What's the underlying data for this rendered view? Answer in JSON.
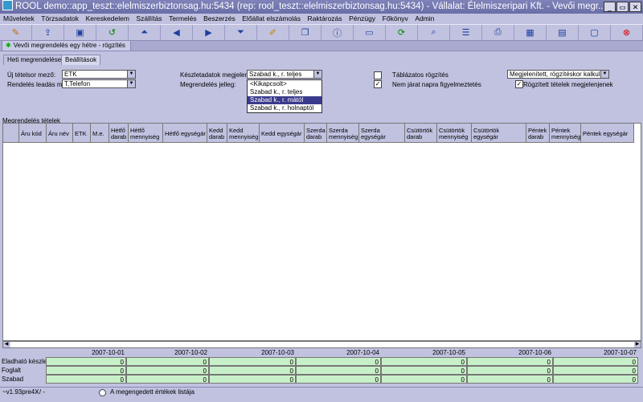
{
  "window": {
    "title": "ROOL demo::app_teszt::elelmiszerbiztonsag.hu:5434 (rep: rool_teszt::elelmiszerbiztonsag.hu:5434) - Vállalat: Élelmiszeripari Kft. - Vevői megr...",
    "min_label": "_",
    "restore_label": "▭",
    "close_label": "✕"
  },
  "menu": [
    "Műveletek",
    "Törzsadatok",
    "Kereskedelem",
    "Szállítás",
    "Termelés",
    "Beszerzés",
    "Előállat elszámolás",
    "Raktározás",
    "Pénzügy",
    "Főkönyv",
    "Admin"
  ],
  "toolbar": [
    "open-icon",
    "export-icon",
    "save-icon",
    "refresh-icon",
    "first-icon",
    "prev-icon",
    "next-icon",
    "last-icon",
    "edit-icon",
    "copy-icon",
    "info-icon",
    "window-icon",
    "reload-icon",
    "search-icon",
    "list-icon",
    "print-icon",
    "grid-icon",
    "table-icon",
    "frame-icon",
    "close-icon"
  ],
  "doc_tab": "Vevői megrendelés egy hétre - rögzítés",
  "subtabs": [
    "Heti megrendelések",
    "Beállítások"
  ],
  "form": {
    "new_row_label": "Új tételsor mező:",
    "new_row_value": "ETK",
    "order_mode_label": "Rendelés leadás mód:",
    "order_mode_value": "T,Telefon",
    "stock_label": "Készletadatok megjelenítés:",
    "stock_value": "Szabad k., r. teljes",
    "order_type_label": "Megrendelés jelleg:",
    "tabular_label": "Táblázatos rögzítés",
    "not_today_label": "Nem járat napra figyelmeztetés",
    "display_value": "Megjelenített, rögzítéskor kalkulált",
    "show_recorded_label": "Rögzített tételek megjelenjenek"
  },
  "dropdown": [
    "<Kikapcsolt>",
    "Szabad k., r. teljes",
    "Szabad k., r. mától",
    "Szabad k., r. holnaptól"
  ],
  "dropdown_selected": 2,
  "grid_title": "Megrendelés tételek",
  "grid_headers": [
    "Áru kód",
    "Áru név",
    "ETK",
    "M.e.",
    "Hétfő darab",
    "Hétfő mennyiség",
    "Hétfő egységár",
    "Kedd darab",
    "Kedd mennyiség",
    "Kedd egységár",
    "Szerda darab",
    "Szerda mennyiség",
    "Szerda egységár",
    "Csütörtök darab",
    "Csütörtök mennyiség",
    "Csütörtök egységár",
    "Péntek darab",
    "Péntek mennyiség",
    "Péntek egységár"
  ],
  "dates": [
    "2007-10-01",
    "2007-10-02",
    "2007-10-03",
    "2007-10-04",
    "2007-10-05",
    "2007-10-06",
    "2007-10-07"
  ],
  "summary_rows": [
    {
      "label": "Eladható készlet",
      "values": [
        "0",
        "0",
        "0",
        "0",
        "0",
        "0",
        "0"
      ]
    },
    {
      "label": "Foglalt",
      "values": [
        "0",
        "0",
        "0",
        "0",
        "0",
        "0",
        "0"
      ]
    },
    {
      "label": "Szabad",
      "values": [
        "0",
        "0",
        "0",
        "0",
        "0",
        "0",
        "0"
      ]
    }
  ],
  "status": {
    "version": "~v1.93pre4X",
    "separator": "- / -",
    "radio_label": "A megengedett értékek listája"
  }
}
